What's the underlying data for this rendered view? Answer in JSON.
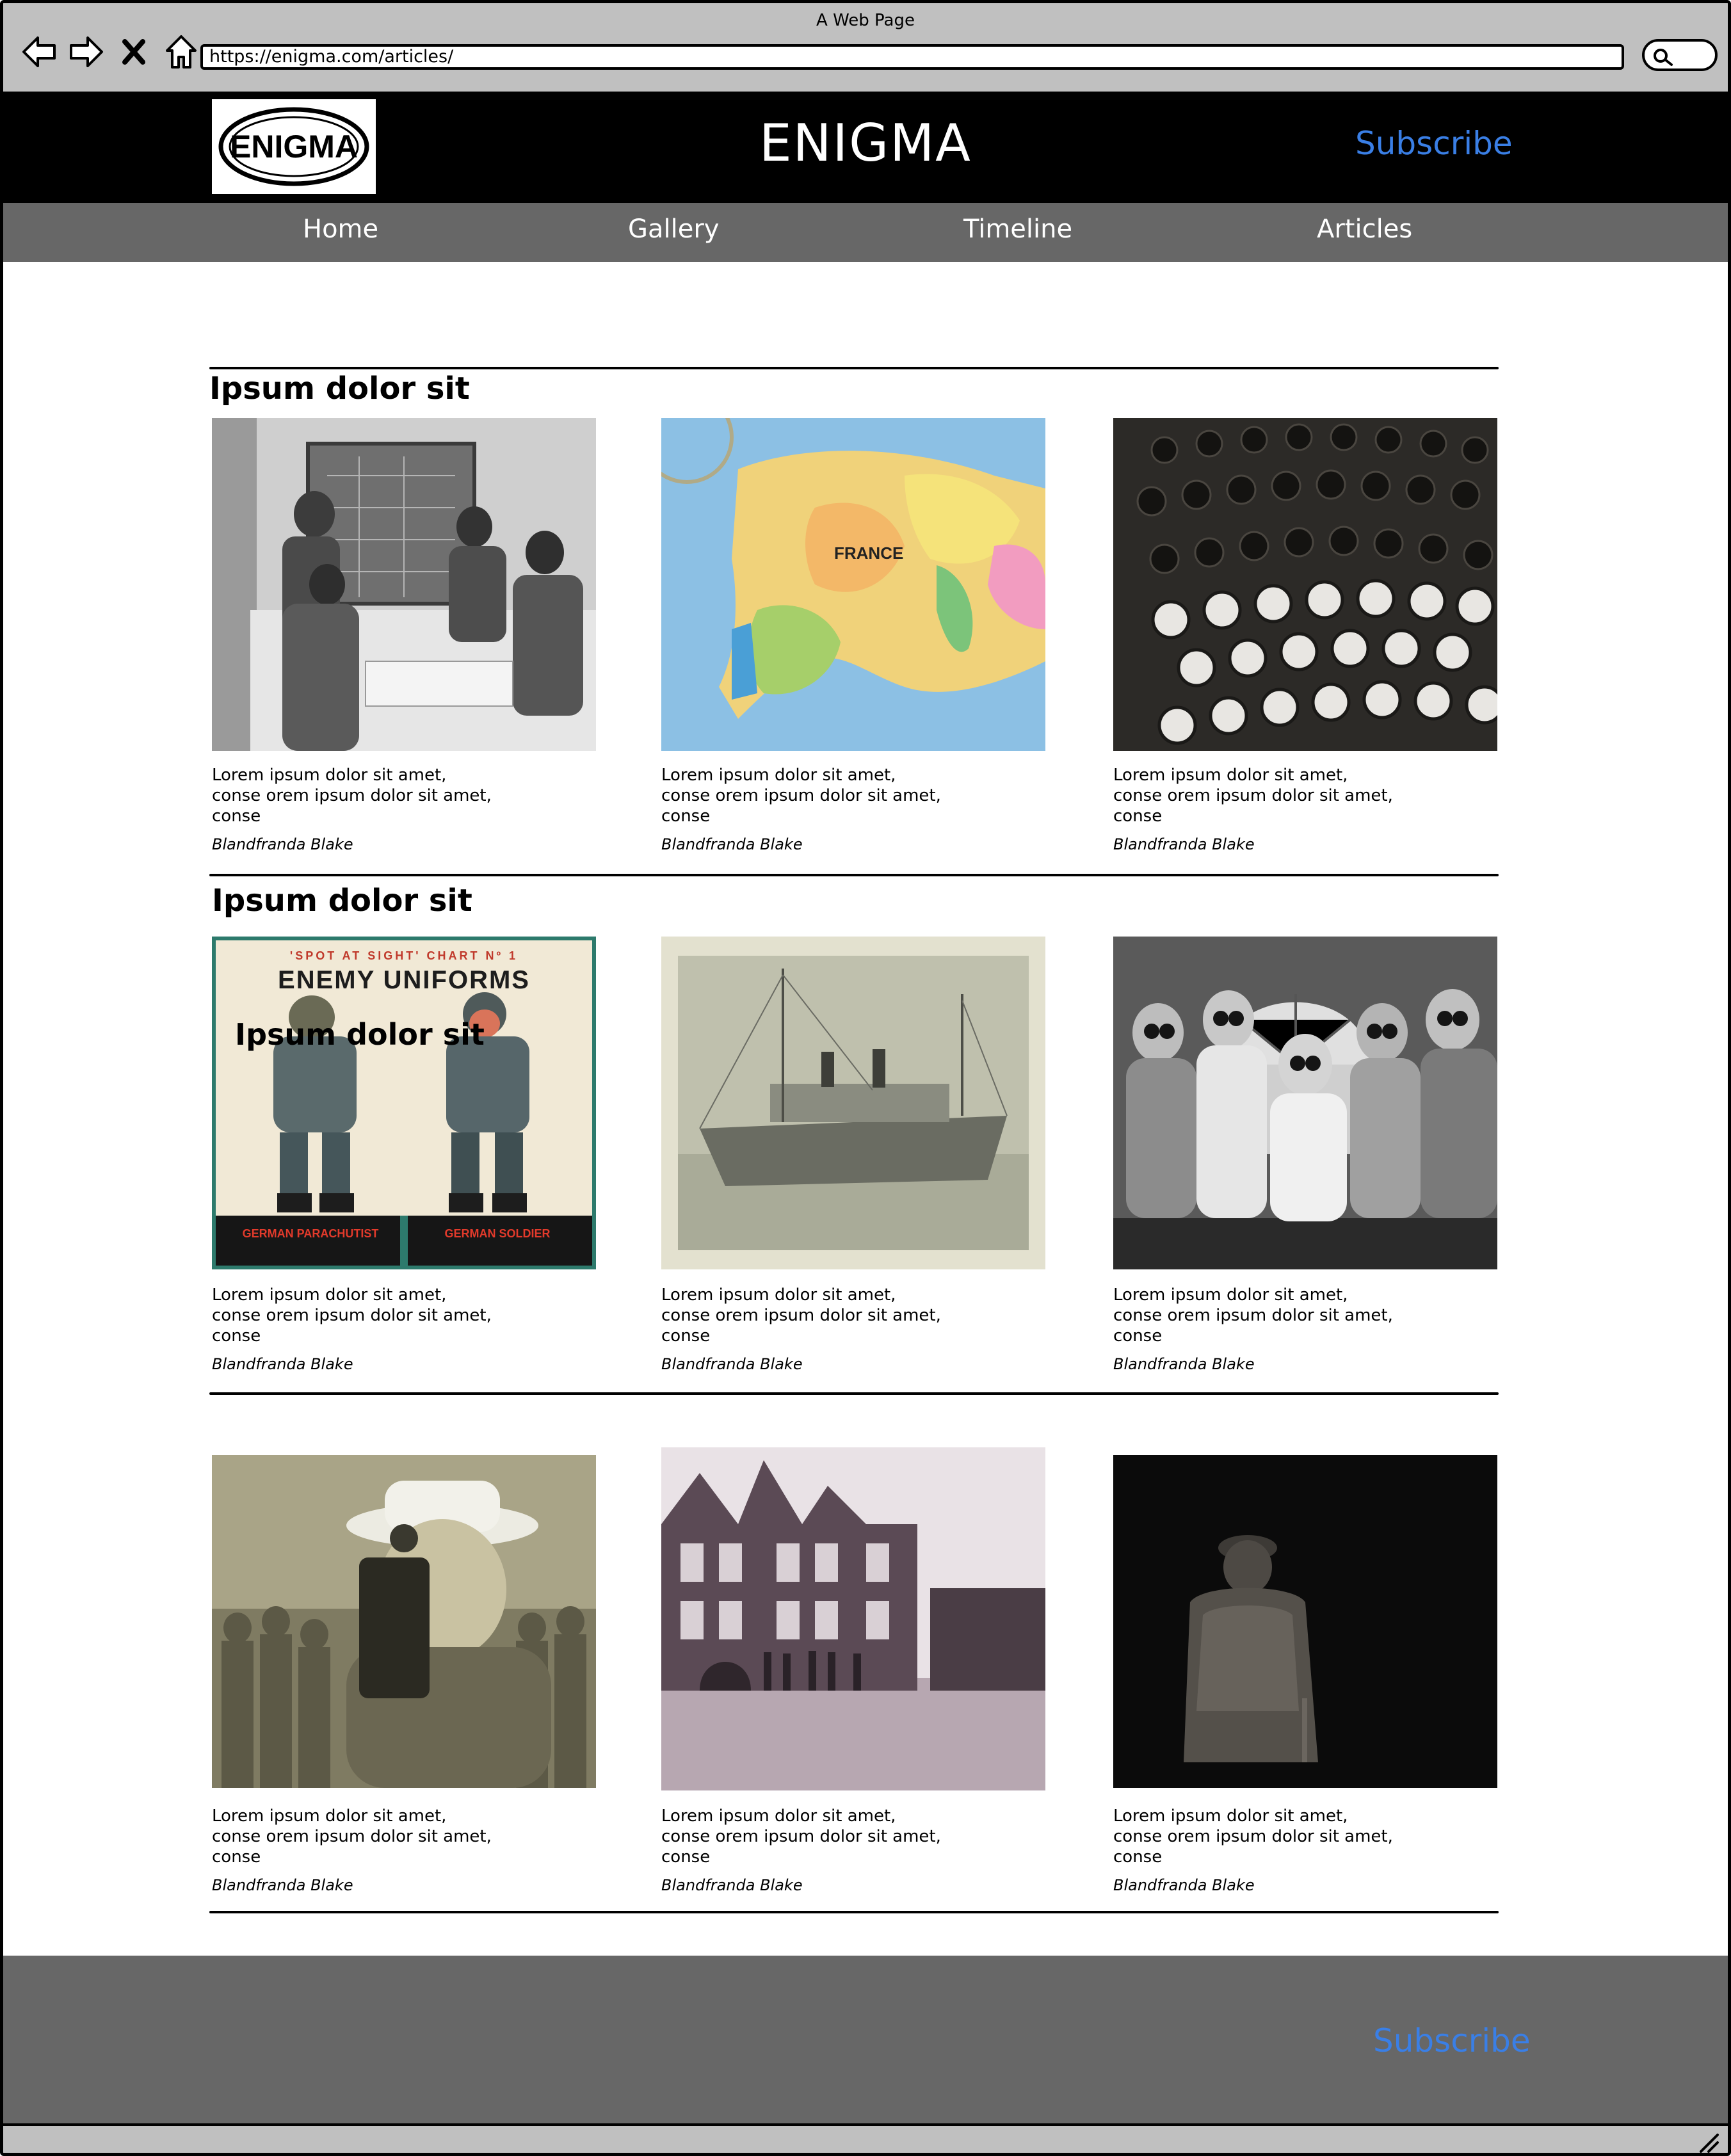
{
  "window": {
    "title": "A Web Page",
    "url": "https://enigma.com/articles/"
  },
  "header": {
    "logo_text": "ENIGMA",
    "site_title": "ENIGMA",
    "subscribe_label": "Subscribe"
  },
  "nav": {
    "items": [
      "Home",
      "Gallery",
      "Timeline",
      "Articles"
    ]
  },
  "sections": [
    {
      "title": "Ipsum dolor sit",
      "cards": [
        {
          "image": "wartime-briefing-room-photo",
          "lines": [
            "Lorem ipsum dolor sit amet,",
            "conse orem ipsum dolor sit amet,",
            "conse"
          ],
          "author": "Blandfranda Blake"
        },
        {
          "image": "europe-globe-map-photo",
          "lines": [
            "Lorem ipsum dolor sit amet,",
            "conse orem ipsum dolor sit amet,",
            "conse"
          ],
          "author": "Blandfranda Blake"
        },
        {
          "image": "enigma-keyboard-photo",
          "lines": [
            "Lorem ipsum dolor sit amet,",
            "conse orem ipsum dolor sit amet,",
            "conse"
          ],
          "author": "Blandfranda Blake"
        }
      ]
    },
    {
      "title": "Ipsum dolor sit",
      "cards": [
        {
          "image": "enemy-uniforms-poster",
          "overlay_title": "Ipsum dolor sit",
          "poster": {
            "top": "'SPOT AT SIGHT' CHART Nº 1",
            "headline": "ENEMY UNIFORMS",
            "left_caption": "GERMAN PARACHUTIST",
            "right_caption": "GERMAN SOLDIER"
          },
          "lines": [
            "Lorem ipsum dolor sit amet,",
            "conse orem ipsum dolor sit amet,",
            "conse"
          ],
          "author": "Blandfranda Blake"
        },
        {
          "image": "ship-photo",
          "lines": [
            "Lorem ipsum dolor sit amet,",
            "conse orem ipsum dolor sit amet,",
            "conse"
          ],
          "author": "Blandfranda Blake"
        },
        {
          "image": "women-workers-goggles-photo",
          "lines": [
            "Lorem ipsum dolor sit amet,",
            "conse orem ipsum dolor sit amet,",
            "conse"
          ],
          "author": "Blandfranda Blake"
        }
      ]
    },
    {
      "title": "",
      "cards": [
        {
          "image": "man-with-camera-photo",
          "lines": [
            "Lorem ipsum dolor sit amet,",
            "conse orem ipsum dolor sit amet,",
            "conse"
          ],
          "author": "Blandfranda Blake"
        },
        {
          "image": "bletchley-mansion-photo",
          "lines": [
            "Lorem ipsum dolor sit amet,",
            "conse orem ipsum dolor sit amet,",
            "conse"
          ],
          "author": "Blandfranda Blake"
        },
        {
          "image": "statue-in-dark-photo",
          "lines": [
            "Lorem ipsum dolor sit amet,",
            "conse orem ipsum dolor sit amet,",
            "conse"
          ],
          "author": "Blandfranda Blake"
        }
      ]
    }
  ],
  "footer": {
    "subscribe_label": "Subscribe"
  },
  "colors": {
    "header_bg": "#000000",
    "nav_bg": "#676767",
    "link": "#3a7fe6",
    "chrome": "#c0c0c0"
  },
  "icons": [
    "back-arrow-icon",
    "forward-arrow-icon",
    "close-icon",
    "home-icon",
    "search-icon",
    "resize-grip-icon"
  ]
}
